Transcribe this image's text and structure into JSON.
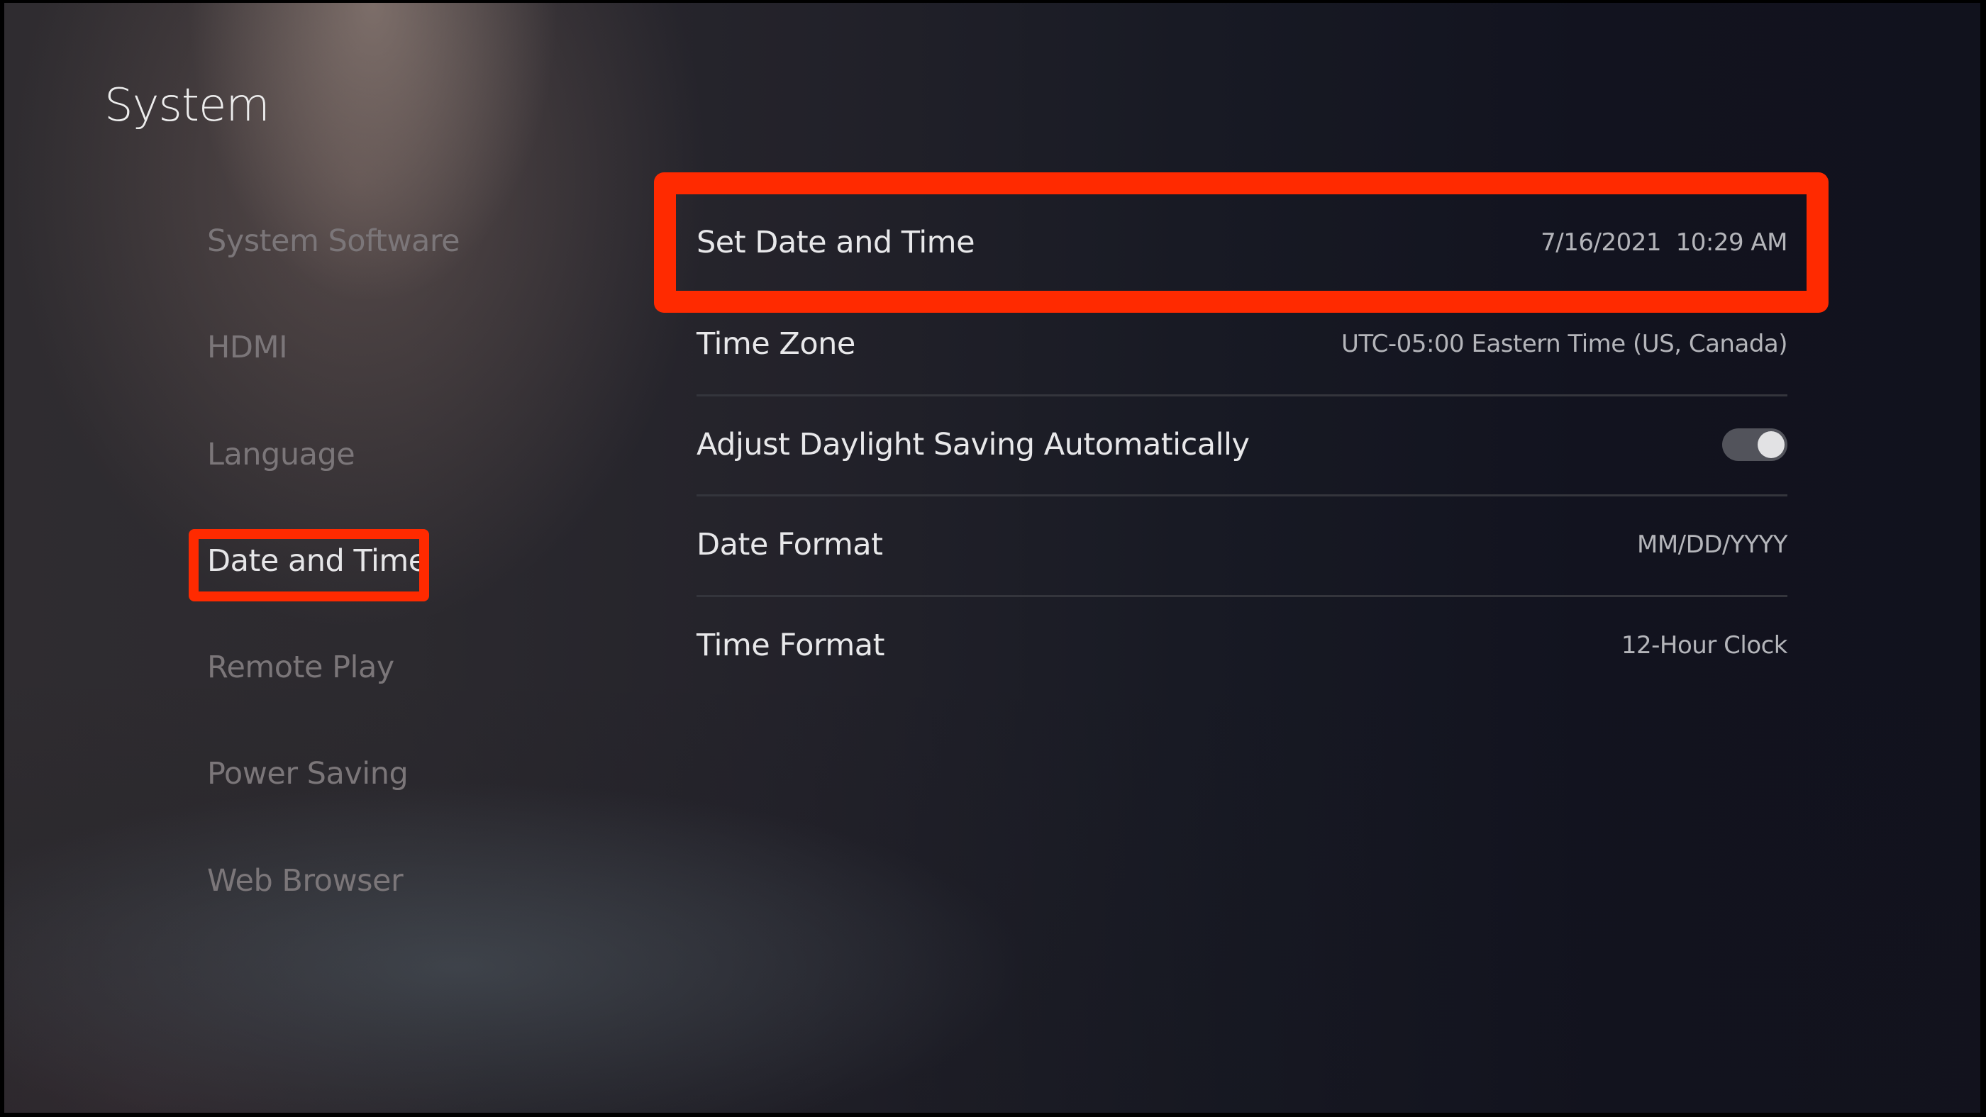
{
  "header": {
    "title": "System"
  },
  "sidebar": {
    "items": [
      {
        "label": "System Software",
        "selected": false
      },
      {
        "label": "HDMI",
        "selected": false
      },
      {
        "label": "Language",
        "selected": false
      },
      {
        "label": "Date and Time",
        "selected": true
      },
      {
        "label": "Remote Play",
        "selected": false
      },
      {
        "label": "Power Saving",
        "selected": false
      },
      {
        "label": "Web Browser",
        "selected": false
      }
    ]
  },
  "main": {
    "rows": [
      {
        "label": "Set Date and Time",
        "value": "7/16/2021  10:29 AM",
        "focused": true
      },
      {
        "label": "Time Zone",
        "value": "UTC-05:00 Eastern Time (US, Canada)"
      },
      {
        "label": "Adjust Daylight Saving Automatically",
        "toggle": true,
        "toggle_on": true
      },
      {
        "label": "Date Format",
        "value": "MM/DD/YYYY"
      },
      {
        "label": "Time Format",
        "value": "12-Hour Clock"
      }
    ]
  },
  "colors": {
    "highlight": "#ff2a00",
    "toggle_track": "#52535b",
    "toggle_knob": "#e2e2e4"
  }
}
